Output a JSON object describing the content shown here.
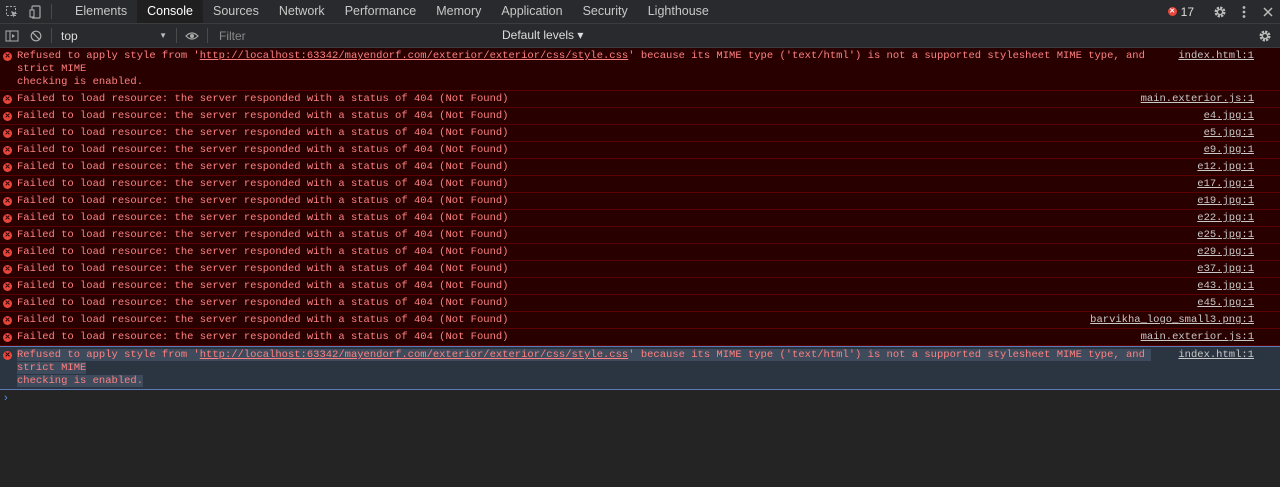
{
  "toolbar": {
    "tabs": [
      {
        "label": "Elements"
      },
      {
        "label": "Console"
      },
      {
        "label": "Sources"
      },
      {
        "label": "Network"
      },
      {
        "label": "Performance"
      },
      {
        "label": "Memory"
      },
      {
        "label": "Application"
      },
      {
        "label": "Security"
      },
      {
        "label": "Lighthouse"
      }
    ],
    "active_tab": "Console",
    "error_count": "17"
  },
  "filterbar": {
    "context": "top",
    "filter_placeholder": "Filter",
    "levels": "Default levels ▾"
  },
  "messages": [
    {
      "prefix": "Refused to apply style from '",
      "link": "http://localhost:63342/mayendorf.com/exterior/exterior/css/style.css",
      "suffix": "' because its MIME type ('text/html') is not a supported stylesheet MIME type, and strict MIME\nchecking is enabled.",
      "source": "index.html:1"
    },
    {
      "text": "Failed to load resource: the server responded with a status of 404 (Not Found)",
      "source": "main.exterior.js:1"
    },
    {
      "text": "Failed to load resource: the server responded with a status of 404 (Not Found)",
      "source": "e4.jpg:1"
    },
    {
      "text": "Failed to load resource: the server responded with a status of 404 (Not Found)",
      "source": "e5.jpg:1"
    },
    {
      "text": "Failed to load resource: the server responded with a status of 404 (Not Found)",
      "source": "e9.jpg:1"
    },
    {
      "text": "Failed to load resource: the server responded with a status of 404 (Not Found)",
      "source": "e12.jpg:1"
    },
    {
      "text": "Failed to load resource: the server responded with a status of 404 (Not Found)",
      "source": "e17.jpg:1"
    },
    {
      "text": "Failed to load resource: the server responded with a status of 404 (Not Found)",
      "source": "e19.jpg:1"
    },
    {
      "text": "Failed to load resource: the server responded with a status of 404 (Not Found)",
      "source": "e22.jpg:1"
    },
    {
      "text": "Failed to load resource: the server responded with a status of 404 (Not Found)",
      "source": "e25.jpg:1"
    },
    {
      "text": "Failed to load resource: the server responded with a status of 404 (Not Found)",
      "source": "e29.jpg:1"
    },
    {
      "text": "Failed to load resource: the server responded with a status of 404 (Not Found)",
      "source": "e37.jpg:1"
    },
    {
      "text": "Failed to load resource: the server responded with a status of 404 (Not Found)",
      "source": "e43.jpg:1"
    },
    {
      "text": "Failed to load resource: the server responded with a status of 404 (Not Found)",
      "source": "e45.jpg:1"
    },
    {
      "text": "Failed to load resource: the server responded with a status of 404 (Not Found)",
      "source": "barvikha_logo_small3.png:1"
    },
    {
      "text": "Failed to load resource: the server responded with a status of 404 (Not Found)",
      "source": "main.exterior.js:1"
    },
    {
      "prefix": "Refused to apply style from '",
      "link": "http://localhost:63342/mayendorf.com/exterior/exterior/css/style.css",
      "suffix": "' because its MIME type ('text/html') is not a supported stylesheet MIME type, and strict MIME\nchecking is enabled.",
      "source": "index.html:1"
    }
  ],
  "prompt_symbol": "›",
  "colors": {
    "error_bg": "#290000",
    "error_text": "#ff8080",
    "error_icon": "#e8463c",
    "accent": "#5a95f5"
  }
}
